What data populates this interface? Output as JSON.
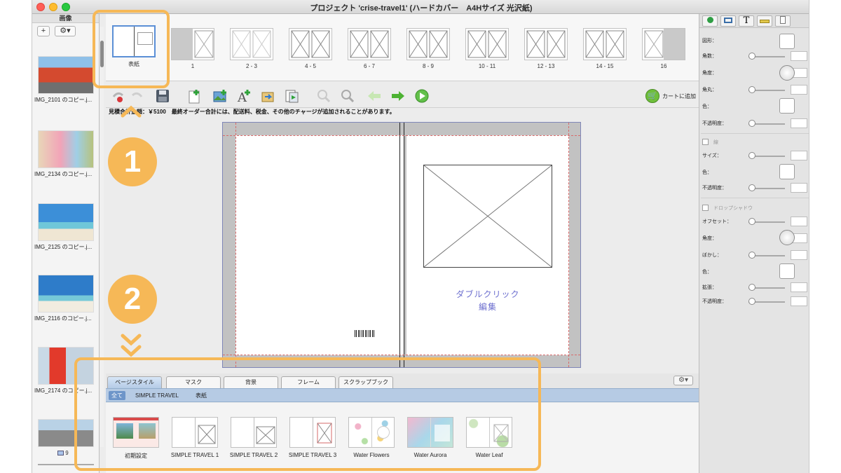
{
  "window": {
    "title": "プロジェクト 'crise-travel1' (ハードカバー　A4Hサイズ 光沢紙)"
  },
  "image_panel": {
    "header": "画像",
    "add_label": "+",
    "gear_label": "⚙▾",
    "items": [
      {
        "caption": "IMG_2101 のコピー.j..."
      },
      {
        "caption": "IMG_2134 のコピー.j..."
      },
      {
        "caption": "IMG_2125 のコピー.j..."
      },
      {
        "caption": "IMG_2116 のコピー.j..."
      },
      {
        "caption": "IMG_2174 のコピー.j..."
      }
    ],
    "footer_count": "9"
  },
  "pages": [
    {
      "label": "表紙"
    },
    {
      "label": "1"
    },
    {
      "label": "2 - 3"
    },
    {
      "label": "4 - 5"
    },
    {
      "label": "6 - 7"
    },
    {
      "label": "8 - 9"
    },
    {
      "label": "10 - 11"
    },
    {
      "label": "12 - 13"
    },
    {
      "label": "14 - 15"
    },
    {
      "label": "16"
    }
  ],
  "toolbar": {
    "icons": [
      "undo-icon",
      "redo-icon",
      "save-icon",
      "new-page-icon",
      "add-image-icon",
      "add-text-icon",
      "export-icon",
      "preview-icon",
      "zoom-out-icon",
      "zoom-in-icon",
      "back-arrow-icon",
      "forward-arrow-icon",
      "play-icon"
    ],
    "cart_label": "カートに追加"
  },
  "notice": "見積合計金額：￥5100　最終オーダー合計には、配送料、税金、その他のチャージが追加されることがあります。",
  "canvas": {
    "placeholder_line1": "ダブルクリック",
    "placeholder_line2": "編集"
  },
  "bottom": {
    "tabs": [
      "ページスタイル",
      "マスク",
      "背景",
      "フレーム",
      "スクラップブック"
    ],
    "filters": [
      "全て",
      "SIMPLE TRAVEL",
      "表紙"
    ],
    "styles": [
      {
        "name": "初期設定"
      },
      {
        "name": "SIMPLE TRAVEL 1"
      },
      {
        "name": "SIMPLE TRAVEL 2"
      },
      {
        "name": "SIMPLE TRAVEL 3"
      },
      {
        "name": "Water Flowers"
      },
      {
        "name": "Water Aurora"
      },
      {
        "name": "Water Leaf"
      }
    ]
  },
  "props": {
    "tab_icons": [
      "shape-tab-icon",
      "frame-tab-icon",
      "text-tab-icon",
      "ruler-tab-icon",
      "page-tab-icon"
    ],
    "text_tab_label": "T",
    "shape_label": "図形：",
    "corners_label": "角数：",
    "angle_label": "角度：",
    "roundness_label": "角丸：",
    "color_label": "色：",
    "opacity_label": "不透明度：",
    "border_label": "線",
    "size_label": "サイズ：",
    "shadow_label": "ドロップシャドウ",
    "offset_label": "オフセット：",
    "blur_label": "ぼかし：",
    "spread_label": "拡張："
  },
  "annotations": {
    "step1": "1",
    "step2": "2"
  },
  "colors": {
    "accent": "#f6b857",
    "selection": "#6d95c9"
  }
}
